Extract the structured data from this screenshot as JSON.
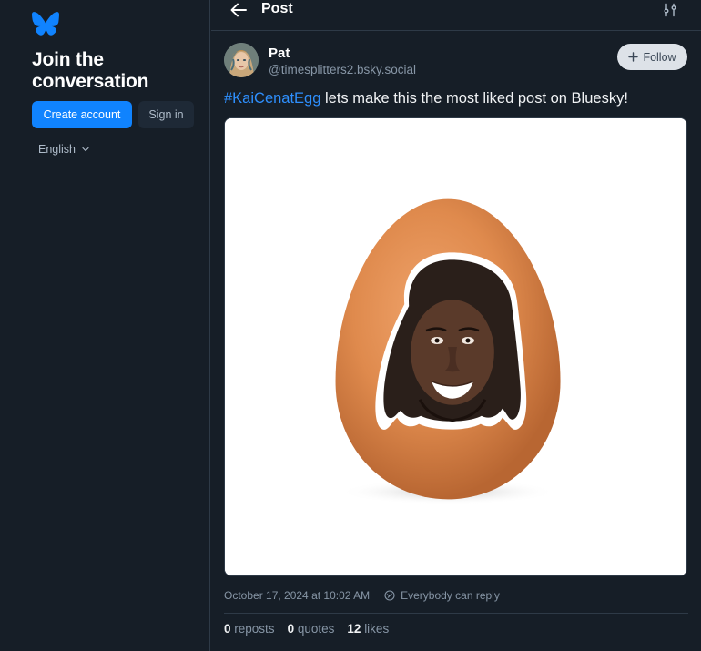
{
  "sidebar": {
    "logo_icon": "bluesky-butterfly-icon",
    "title": "Join the conversation",
    "create_account_label": "Create account",
    "sign_in_label": "Sign in",
    "language_label": "English",
    "accent_color": "#1083fe"
  },
  "header": {
    "title": "Post",
    "back_icon": "arrow-left-icon",
    "settings_icon": "sliders-icon"
  },
  "post": {
    "author_name": "Pat",
    "author_handle": "@timesplitters2.bsky.social",
    "follow_label": "Follow",
    "hashtag": "#KaiCenatEgg",
    "text": " lets make this the most liked post on Bluesky!",
    "timestamp": "October 17, 2024 at 10:02 AM",
    "reply_setting": "Everybody can reply",
    "stats": {
      "reposts_count": "0",
      "reposts_label": "reposts",
      "quotes_count": "0",
      "quotes_label": "quotes",
      "likes_count": "12",
      "likes_label": "likes"
    }
  }
}
